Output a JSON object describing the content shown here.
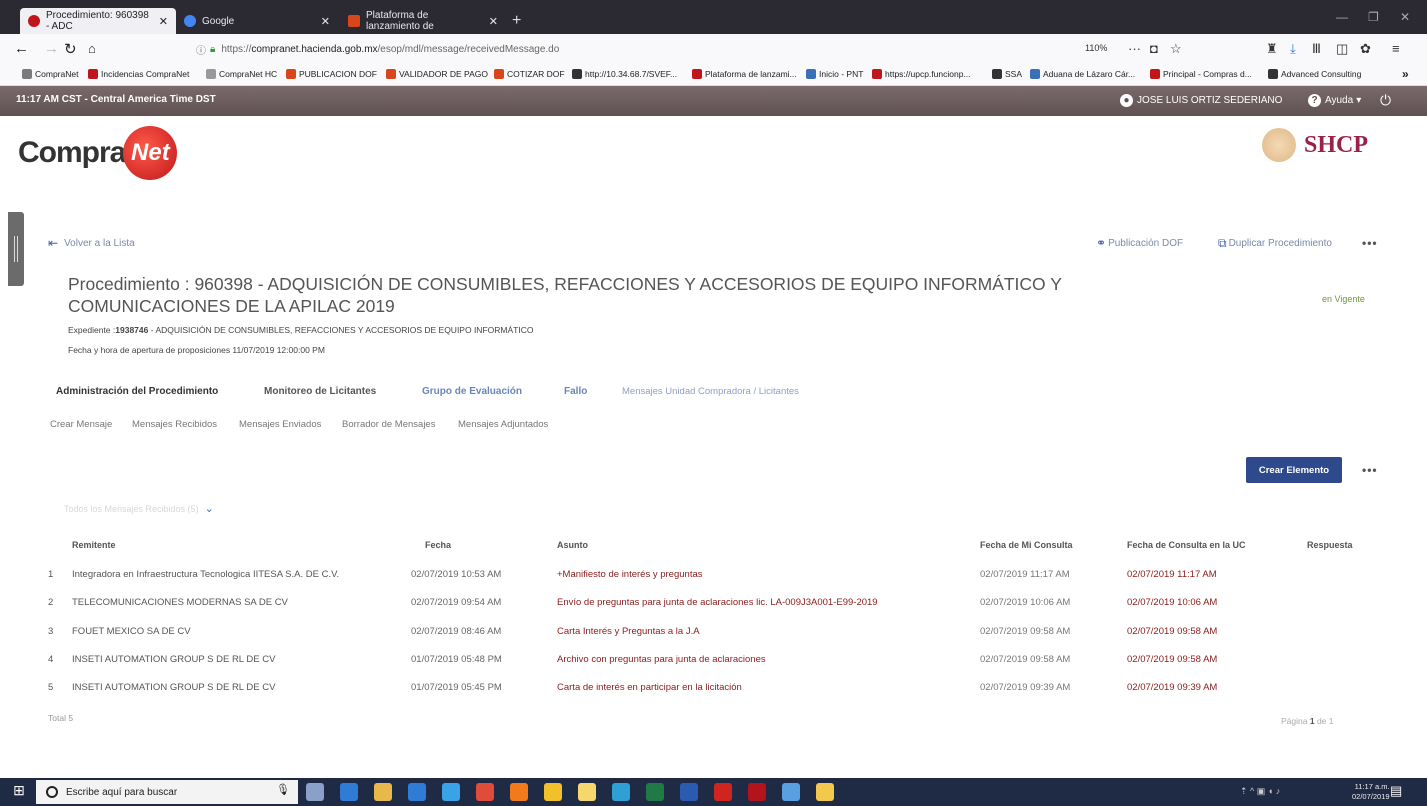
{
  "browser": {
    "tabs": [
      {
        "label": "Procedimiento: 960398 - ADC",
        "active": true
      },
      {
        "label": "Google",
        "active": false
      },
      {
        "label": "Plataforma de lanzamiento de",
        "active": false
      }
    ],
    "url_prefix": "https://",
    "url_host": "compranet.hacienda.gob.mx",
    "url_path": "/esop/mdl/message/receivedMessage.do",
    "zoom": "110%",
    "bookmarks": [
      {
        "label": "CompraNet",
        "color": "#7b7b7b"
      },
      {
        "label": "Incidencias CompraNet",
        "color": "#c0161b"
      },
      {
        "label": "CompraNet HC",
        "color": "#999999"
      },
      {
        "label": "PUBLICACION DOF",
        "color": "#d9461c"
      },
      {
        "label": "VALIDADOR DE PAGO",
        "color": "#d9461c"
      },
      {
        "label": "COTIZAR DOF",
        "color": "#d9461c"
      },
      {
        "label": "http://10.34.68.7/SVEF...",
        "color": "#333333"
      },
      {
        "label": "Plataforma de lanzami...",
        "color": "#c0161b"
      },
      {
        "label": "Inicio - PNT",
        "color": "#3b6fb8"
      },
      {
        "label": "https://upcp.funcionp...",
        "color": "#c0161b"
      },
      {
        "label": "SSA",
        "color": "#333333"
      },
      {
        "label": "Aduana de Lázaro Cár...",
        "color": "#3b6fb8"
      },
      {
        "label": "Principal - Compras d...",
        "color": "#c0161b"
      },
      {
        "label": "Advanced Consulting",
        "color": "#333333"
      }
    ]
  },
  "header": {
    "clock": "11:17 AM CST - Central America Time DST",
    "user": "JOSE LUIS ORTIZ SEDERIANO",
    "help": "Ayuda"
  },
  "logos": {
    "compra": "Compra",
    "net": "Net",
    "shcp": "SHCP"
  },
  "content": {
    "back_label": "Volver a la Lista",
    "publicacion_label": "Publicación DOF",
    "duplicar_label": "Duplicar Procedimiento",
    "title": "Procedimiento : 960398 - ADQUISICIÓN DE CONSUMIBLES, REFACCIONES Y ACCESORIOS DE EQUIPO INFORMÁTICO Y COMUNICACIONES DE LA APILAC 2019",
    "status": "en Vigente",
    "expediente_label": "Expediente :",
    "expediente_num": "1938746",
    "expediente_text": " - ADQUISICIÓN DE CONSUMIBLES, REFACCIONES Y ACCESORIOS DE EQUIPO INFORMÁTICO",
    "fecha_apertura": "Fecha y hora de apertura de proposiciones 11/07/2019 12:00:00 PM",
    "main_tabs": [
      "Administración del Procedimiento",
      "Monitoreo de Licitantes",
      "Grupo de Evaluación",
      "Fallo",
      "Mensajes Unidad Compradora / Licitantes"
    ],
    "sub_tabs": [
      "Crear Mensaje",
      "Mensajes Recibidos",
      "Mensajes Enviados",
      "Borrador de Mensajes",
      "Mensajes Adjuntados"
    ],
    "crear_elemento": "Crear Elemento",
    "filter": "Todos los Mensajes Recibidos (5)"
  },
  "table": {
    "headers": [
      "Remitente",
      "Fecha",
      "Asunto",
      "Fecha de Mi Consulta",
      "Fecha de Consulta en la UC",
      "Respuesta"
    ],
    "rows": [
      {
        "num": "1",
        "remitente": "Integradora en Infraestructura Tecnologica IITESA S.A. DE C.V.",
        "fecha": "02/07/2019 10:53 AM",
        "asunto": "+Manifiesto de interés y preguntas",
        "mi": "02/07/2019 11:17 AM",
        "uc": "02/07/2019 11:17 AM"
      },
      {
        "num": "2",
        "remitente": "TELECOMUNICACIONES MODERNAS SA DE CV",
        "fecha": "02/07/2019 09:54 AM",
        "asunto": "Envío de preguntas para junta de aclaraciones lic. LA-009J3A001-E99-2019",
        "mi": "02/07/2019 10:06 AM",
        "uc": "02/07/2019 10:06 AM"
      },
      {
        "num": "3",
        "remitente": "FOUET MEXICO SA DE CV",
        "fecha": "02/07/2019 08:46 AM",
        "asunto": "Carta Interés y Preguntas a la J.A",
        "mi": "02/07/2019 09:58 AM",
        "uc": "02/07/2019 09:58 AM"
      },
      {
        "num": "4",
        "remitente": "INSETI AUTOMATION GROUP S DE RL DE CV",
        "fecha": "01/07/2019 05:48 PM",
        "asunto": "Archivo con preguntas para junta de aclaraciones",
        "mi": "02/07/2019 09:58 AM",
        "uc": "02/07/2019 09:58 AM"
      },
      {
        "num": "5",
        "remitente": "INSETI AUTOMATION GROUP S DE RL DE CV",
        "fecha": "01/07/2019 05:45 PM",
        "asunto": "Carta de interés en participar en la licitación",
        "mi": "02/07/2019 09:39 AM",
        "uc": "02/07/2019 09:39 AM"
      }
    ],
    "total": "Total 5",
    "pagina_label": "Página",
    "pagina_num": "1",
    "pagina_of": "de 1"
  },
  "taskbar": {
    "search_placeholder": "Escribe aquí para buscar",
    "time": "11:17 a.m.",
    "date": "02/07/2019",
    "icons": [
      "task-view-icon",
      "edge-icon",
      "file-explorer-icon",
      "store-icon",
      "ie-icon",
      "chrome-icon",
      "firefox-icon",
      "folder-icon",
      "sticky-icon",
      "photos-icon",
      "excel-icon",
      "word-icon",
      "pdf-icon",
      "acrobat-icon",
      "paint-icon",
      "pen-icon"
    ],
    "icon_colors": [
      "#8aa0c8",
      "#2f7bd6",
      "#e8b84a",
      "#2f7bd6",
      "#3aa3e8",
      "#e04c3a",
      "#f27a1a",
      "#f2c02a",
      "#f5d76e",
      "#2fa0d6",
      "#1f7a45",
      "#2b5bb0",
      "#d0251f",
      "#b3131b",
      "#5aa0e0",
      "#f2c94c"
    ]
  }
}
